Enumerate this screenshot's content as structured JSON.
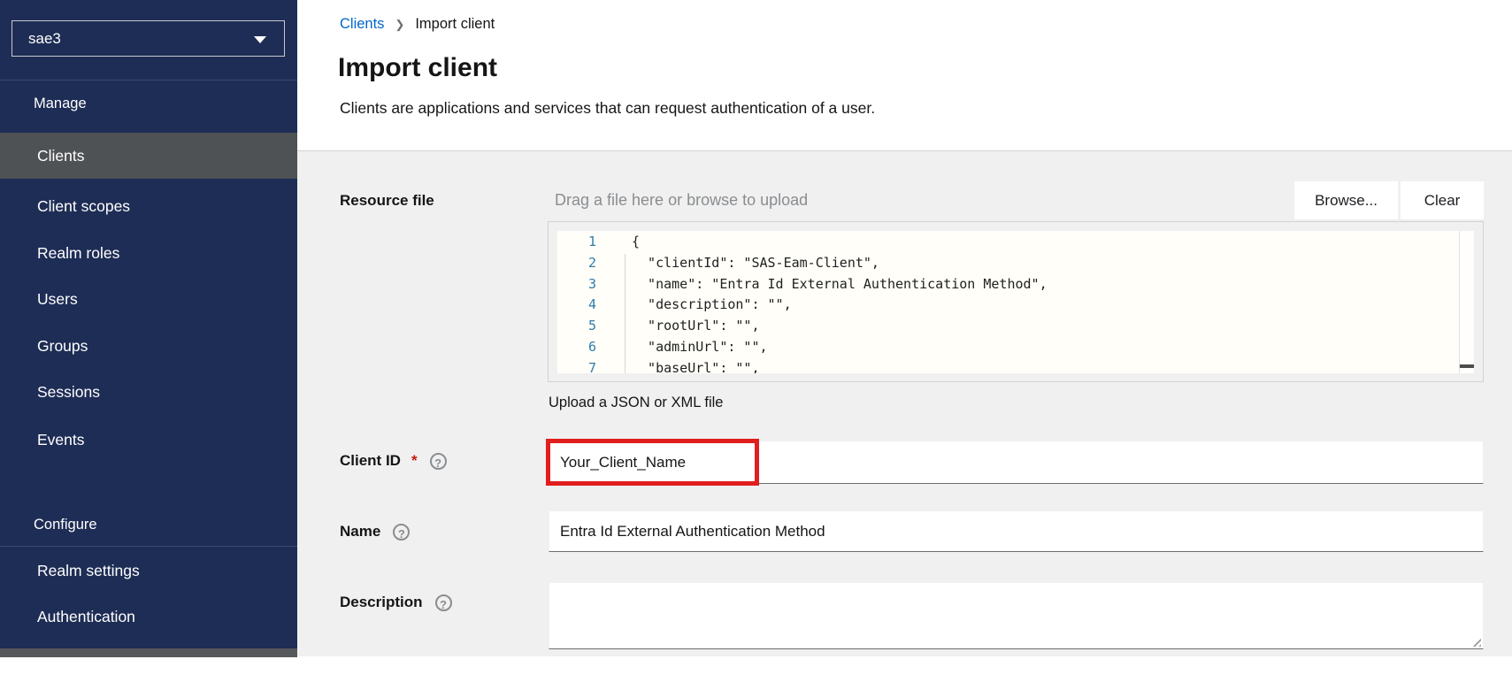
{
  "sidebar": {
    "realm": "sae3",
    "sections": [
      {
        "label": "Manage",
        "items": [
          {
            "label": "Clients",
            "selected": true
          },
          {
            "label": "Client scopes",
            "selected": false
          },
          {
            "label": "Realm roles",
            "selected": false
          },
          {
            "label": "Users",
            "selected": false
          },
          {
            "label": "Groups",
            "selected": false
          },
          {
            "label": "Sessions",
            "selected": false
          },
          {
            "label": "Events",
            "selected": false
          }
        ]
      },
      {
        "label": "Configure",
        "items": [
          {
            "label": "Realm settings",
            "selected": false
          },
          {
            "label": "Authentication",
            "selected": false
          }
        ]
      }
    ]
  },
  "breadcrumb": {
    "parent": "Clients",
    "separator": "❯",
    "current": "Import client"
  },
  "header": {
    "title": "Import client",
    "subtitle": "Clients are applications and services that can request authentication of a user."
  },
  "form": {
    "resource_file": {
      "label": "Resource file",
      "placeholder": "Drag a file here or browse to upload",
      "browse_label": "Browse...",
      "clear_label": "Clear",
      "helper": "Upload a JSON or XML file",
      "code_lines": [
        {
          "n": "1",
          "text": "{"
        },
        {
          "n": "2",
          "text": "  \"clientId\": \"SAS-Eam-Client\","
        },
        {
          "n": "3",
          "text": "  \"name\": \"Entra Id External Authentication Method\","
        },
        {
          "n": "4",
          "text": "  \"description\": \"\","
        },
        {
          "n": "5",
          "text": "  \"rootUrl\": \"\","
        },
        {
          "n": "6",
          "text": "  \"adminUrl\": \"\","
        },
        {
          "n": "7",
          "text": "  \"baseUrl\": \"\","
        }
      ]
    },
    "client_id": {
      "label": "Client ID",
      "required_mark": "*",
      "value": "Your_Client_Name"
    },
    "name": {
      "label": "Name",
      "value": "Entra Id External Authentication Method"
    },
    "description": {
      "label": "Description",
      "value": ""
    }
  },
  "colors": {
    "sidebar_bg": "#1e2d55",
    "sidebar_selected": "#4f5255",
    "link_blue": "#0066cc",
    "section_bg": "#f0f0f0",
    "highlight_red": "#e01e1e",
    "line_number_blue": "#2d7cab",
    "required_red": "#c9190b"
  }
}
